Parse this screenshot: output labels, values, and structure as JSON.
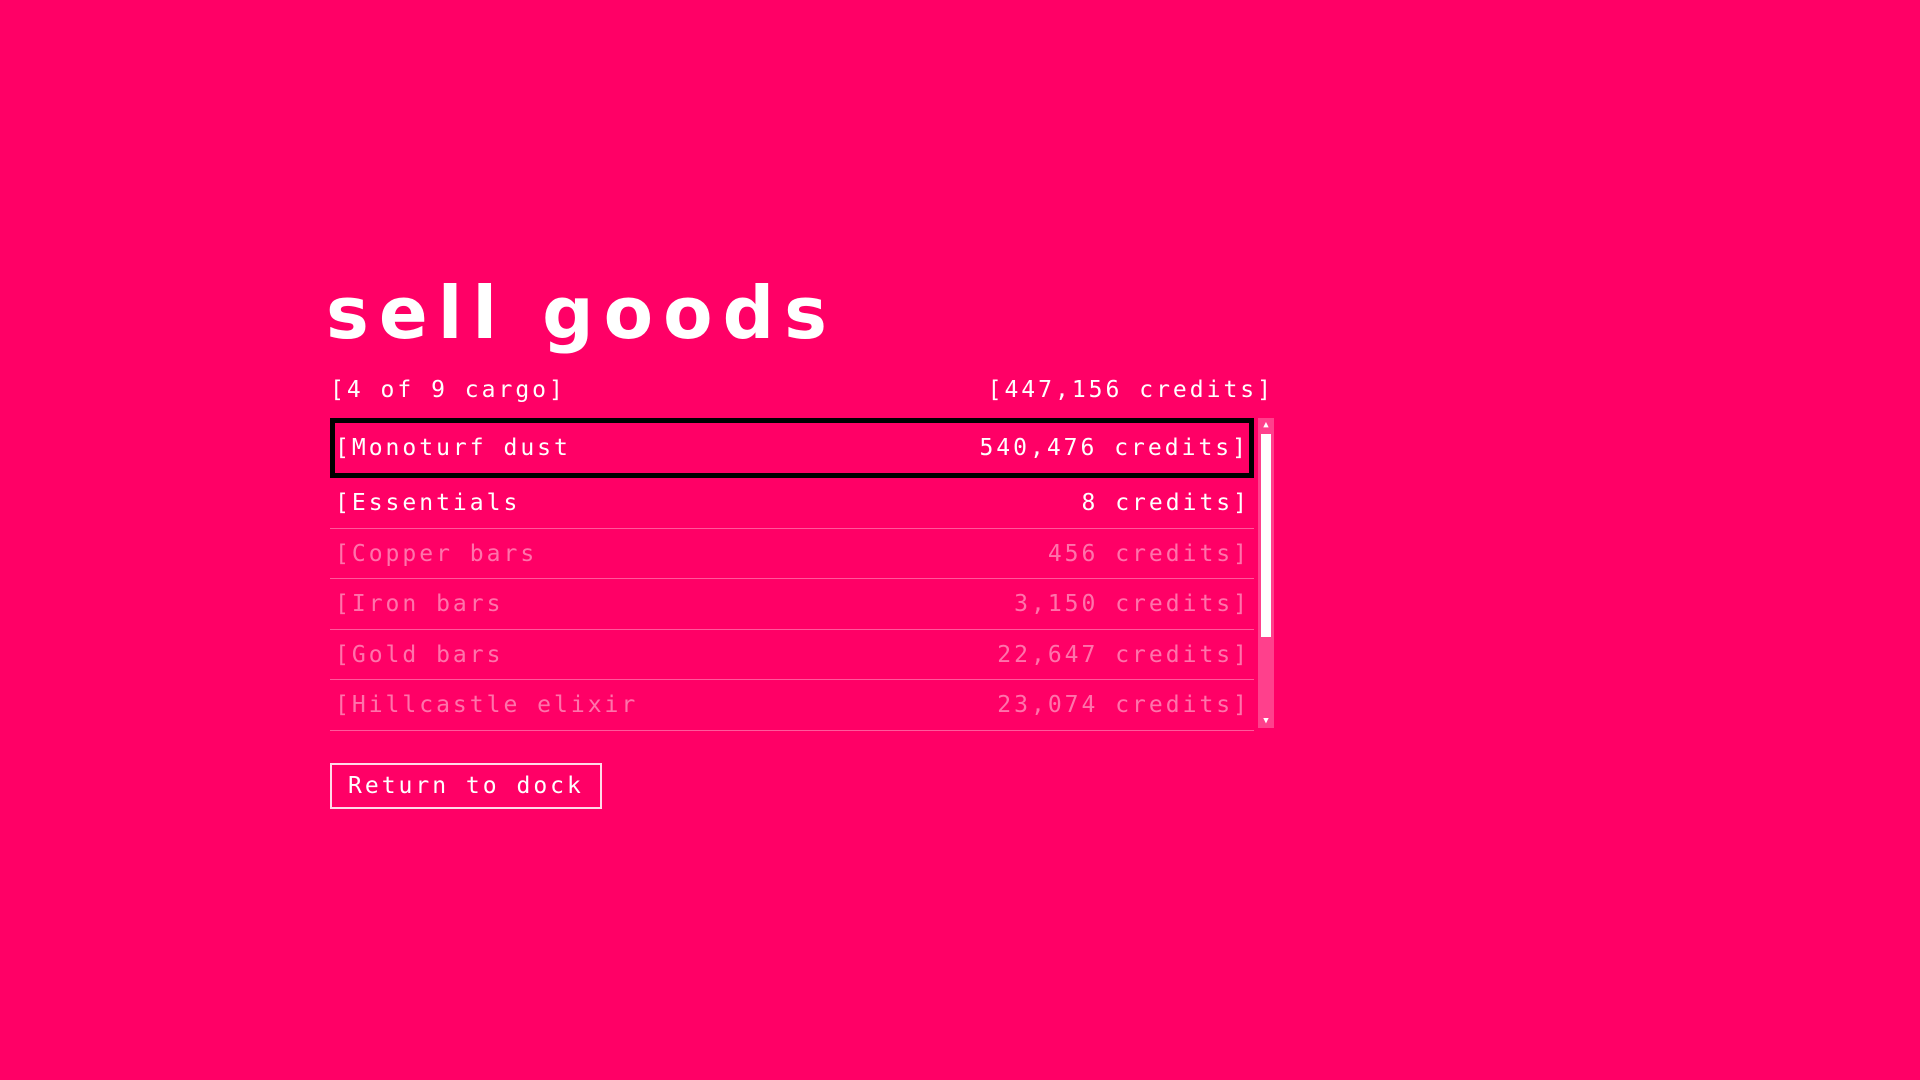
{
  "screen": {
    "title": "sell goods",
    "cargo_status": "[4 of 9 cargo]",
    "credits_status": "[447,156 credits]"
  },
  "goods": [
    {
      "name": "[Monoturf dust",
      "price": "540,476 credits]",
      "state": "selected"
    },
    {
      "name": "[Essentials",
      "price": "8 credits]",
      "state": "available"
    },
    {
      "name": "[Copper bars",
      "price": "456 credits]",
      "state": "dimmed"
    },
    {
      "name": "[Iron bars",
      "price": "3,150 credits]",
      "state": "dimmed"
    },
    {
      "name": "[Gold bars",
      "price": "22,647 credits]",
      "state": "dimmed"
    },
    {
      "name": "[Hillcastle elixir",
      "price": "23,074 credits]",
      "state": "dimmed"
    }
  ],
  "scrollbar": {
    "up_icon": "scroll-up-arrow-icon",
    "down_icon": "scroll-down-arrow-icon",
    "visible_fraction": 0.73
  },
  "actions": {
    "return_label": "Return to dock"
  },
  "colors": {
    "background": "#ff0066",
    "text": "#ffffff",
    "selection_border": "#000000"
  }
}
